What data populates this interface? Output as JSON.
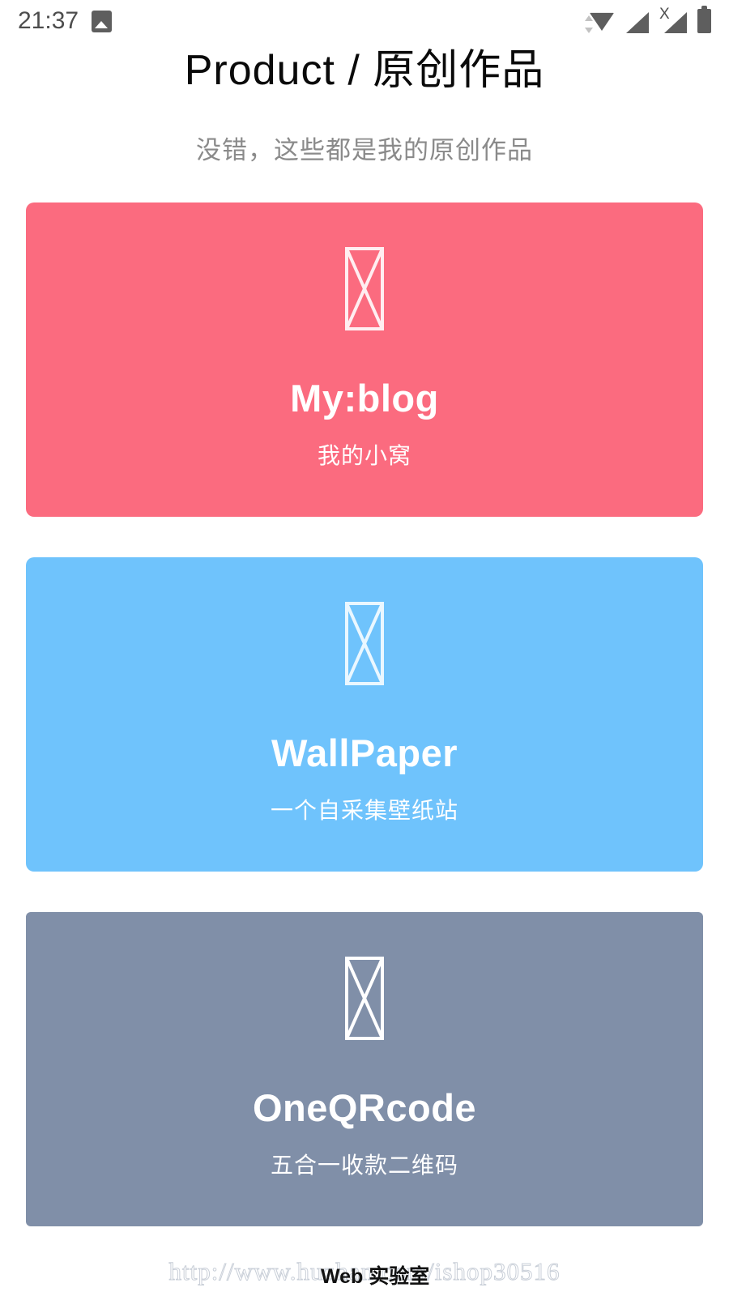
{
  "status_bar": {
    "time": "21:37",
    "left_icons": [
      "photo-icon"
    ],
    "right_icons": [
      "wifi-icon",
      "signal-icon",
      "signal-no-service-icon",
      "battery-icon"
    ],
    "signal_x_label": "X",
    "icon_color": "#5e5e5e"
  },
  "header": {
    "title": "Product  /  原创作品",
    "subtitle": "没错，这些都是我的原创作品",
    "title_color": "#0a0a0a",
    "subtitle_color": "#8a8a8a"
  },
  "cards": [
    {
      "title": "My:blog",
      "desc": "我的小窝",
      "color": "#fb6b7f",
      "icon": "broken-image-icon",
      "theme": "is-pink"
    },
    {
      "title": "WallPaper",
      "desc": "一个自采集壁纸站",
      "color": "#6fc3fc",
      "icon": "broken-image-icon",
      "theme": "is-blue"
    },
    {
      "title": "OneQRcode",
      "desc": "五合一收款二维码",
      "color": "#808fa8",
      "icon": "broken-image-icon",
      "theme": "is-slate"
    }
  ],
  "watermark": {
    "url": "http://www.huzhan.com/ishop30516",
    "brand": "Web 实验室",
    "url_color": "#c9cfd8",
    "brand_color": "#111111"
  }
}
